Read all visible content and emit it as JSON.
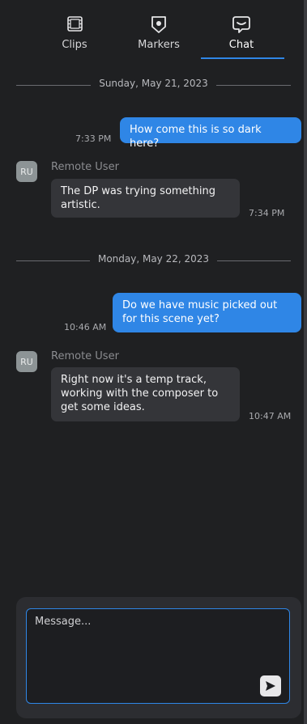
{
  "tabs": [
    {
      "label": "Clips",
      "icon": "clips-icon",
      "active": false
    },
    {
      "label": "Markers",
      "icon": "marker-icon",
      "active": false
    },
    {
      "label": "Chat",
      "icon": "chat-icon",
      "active": true
    }
  ],
  "colors": {
    "accent": "#2f86e6",
    "background": "#1f2022",
    "incoming_bubble": "#343539",
    "avatar": "#8d9496"
  },
  "conversation": [
    {
      "date": "Sunday, May 21, 2023"
    },
    {
      "outgoing": {
        "text": "How come this is so dark here?",
        "time": "7:33 PM"
      }
    },
    {
      "incoming": {
        "initials": "RU",
        "sender": "Remote User",
        "text": "The DP was trying something artistic.",
        "time": "7:34 PM"
      }
    },
    {
      "date": "Monday, May 22, 2023"
    },
    {
      "outgoing": {
        "text": "Do we have music picked out for this scene yet?",
        "time": "10:46 AM"
      }
    },
    {
      "incoming": {
        "initials": "RU",
        "sender": "Remote User",
        "text": "Right now it's a temp track, working with the composer to get some ideas.",
        "time": "10:47 AM"
      }
    }
  ],
  "composer": {
    "placeholder": "Message...",
    "value": "",
    "send_icon": "send-icon"
  }
}
